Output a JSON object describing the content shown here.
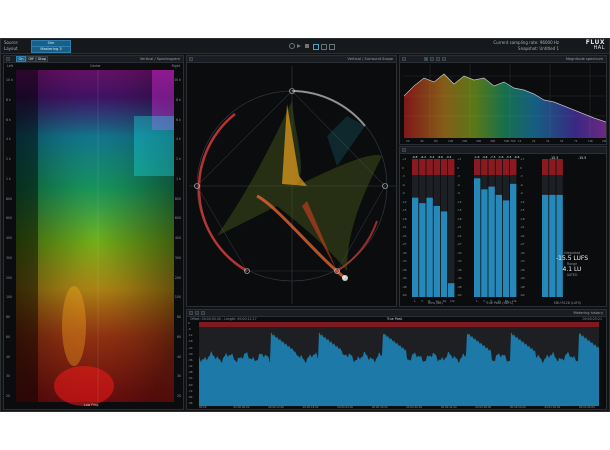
{
  "toolbar": {
    "source_label": "Source",
    "source_value": "Sim",
    "layout_label": "Layout",
    "layout_value": "Mastering 3",
    "status_line1": "Current sampling rate: 96000 Hz",
    "status_line2": "Snapshot: Untitled 1",
    "logo_top": "FLUX",
    "logo_bottom": "HAL"
  },
  "spectrogram": {
    "left_label": "Left",
    "center_label": "Center",
    "right_label": "Right",
    "title": "Vertical / Spectrogram",
    "bottom_label": "Low Freq.",
    "toggle_on": "On",
    "toggle_off": "Off",
    "toggle_stop": "Stop",
    "freq_ticks": [
      "10 k",
      "8 k",
      "6 k",
      "4 k",
      "2 k",
      "1 k",
      "800",
      "600",
      "400",
      "300",
      "200",
      "100",
      "80",
      "60",
      "40",
      "30",
      "20"
    ]
  },
  "vectorscope": {
    "title": "Vertical / Surround Scope"
  },
  "spectrum": {
    "title": "Magnitude spectrum",
    "freq_ticks": [
      "20",
      "40",
      "80",
      "100",
      "200",
      "300",
      "400",
      "500 700",
      "1k",
      "2k",
      "3k",
      "5k",
      "7k",
      "10k",
      "20k"
    ]
  },
  "meters": {
    "rms_label": "Rms (dB)",
    "truepeak_label": "True Peak (dBFS)",
    "ebu_label": "EBU R128 (LUFS)",
    "rms_values": [
      "-6.8",
      "-6.4",
      "-5.4",
      "-6.6",
      "-0.4"
    ],
    "tp_values": [
      "-1.9",
      "-4.6",
      "-7.3",
      "-1.6",
      "-5.5",
      "-6.6"
    ],
    "ebu_header": "-15.3",
    "ebu_header2": "-15.5",
    "db_scale": [
      "+3",
      "0",
      "-3",
      "-6",
      "-9",
      "-12",
      "-15",
      "-18",
      "-21",
      "-24",
      "-27",
      "-30",
      "-33",
      "-36",
      "-40",
      "-48",
      "-60"
    ],
    "integrated_label": "Integrated",
    "integrated_value": "-15.5 LUFS",
    "range_label": "Range",
    "range_value": "4.1 LU",
    "gated_label": "GATED",
    "channel_labels": [
      "L",
      "C",
      "R",
      "Ls",
      "Rs",
      "Lfe"
    ]
  },
  "history": {
    "left_info": "Offset: 00:00:00.00 - Length: 00:00:12.17",
    "center_title": "True Peak",
    "right_info": "Metering history",
    "time_ticks": [
      "00:00",
      "00:00:06:00",
      "00:00:12:00",
      "00:00:18:00",
      "00:00:24:00",
      "00:00:30:00",
      "00:00:36:00",
      "00:00:42:00",
      "00:00:48:00",
      "00:00:54:00",
      "00:01:00:00",
      "00:01:06:00"
    ],
    "y_ticks": [
      "0",
      "-6",
      "-12",
      "-18",
      "-24",
      "-30",
      "-36",
      "-42",
      "-48",
      "-54",
      "-60",
      "-72",
      "-84",
      "-96"
    ],
    "right_stamp": "00:00:25:21"
  },
  "colors": {
    "accent": "#1a6fa0",
    "meter_blue": "#2a8fbf",
    "meter_red": "#8a1a1f",
    "history_fill": "#1d7fb0",
    "vectorscope_ring": "#d43a3a"
  }
}
